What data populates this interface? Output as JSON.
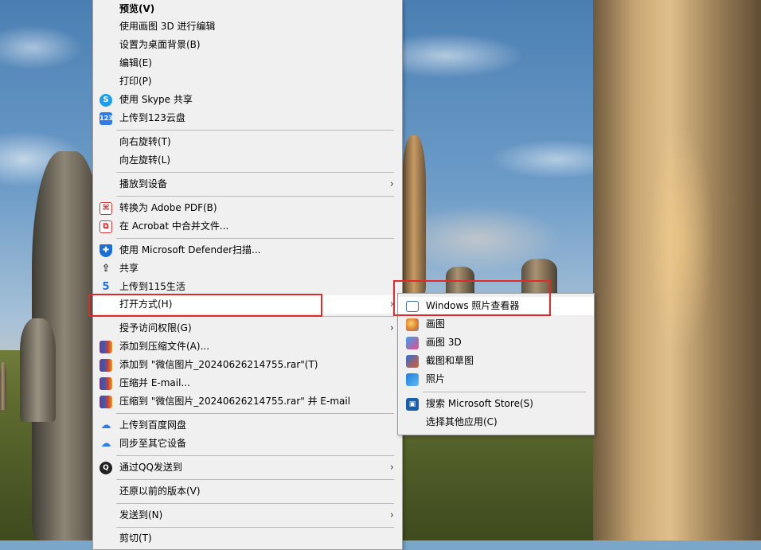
{
  "context_menu": {
    "items": [
      {
        "label": "预览(V)"
      },
      {
        "label": "使用画图 3D 进行编辑"
      },
      {
        "label": "设置为桌面背景(B)"
      },
      {
        "label": "编辑(E)"
      },
      {
        "label": "打印(P)"
      },
      {
        "label": "使用 Skype 共享",
        "icon": "skype-icon"
      },
      {
        "label": "上传到123云盘",
        "icon": "123-cloud-icon",
        "icon_text": "123"
      },
      {
        "label": "向右旋转(T)"
      },
      {
        "label": "向左旋转(L)"
      },
      {
        "label": "播放到设备",
        "has_submenu": true
      },
      {
        "label": "转换为 Adobe PDF(B)",
        "icon": "adobe-pdf-icon"
      },
      {
        "label": "在 Acrobat 中合并文件...",
        "icon": "acrobat-combine-icon"
      },
      {
        "label": "使用 Microsoft Defender扫描...",
        "icon": "defender-shield-icon"
      },
      {
        "label": "共享",
        "icon": "share-icon"
      },
      {
        "label": "上传到115生活",
        "icon": "115-icon"
      },
      {
        "label": "打开方式(H)",
        "has_submenu": true,
        "highlighted": true
      },
      {
        "label": "授予访问权限(G)",
        "has_submenu": true
      },
      {
        "label": "添加到压缩文件(A)...",
        "icon": "winrar-icon"
      },
      {
        "label": "添加到 \"微信图片_20240626214755.rar\"(T)",
        "icon": "winrar-icon"
      },
      {
        "label": "压缩并 E-mail...",
        "icon": "winrar-icon"
      },
      {
        "label": "压缩到 \"微信图片_20240626214755.rar\" 并 E-mail",
        "icon": "winrar-icon"
      },
      {
        "label": "上传到百度网盘",
        "icon": "baidu-netdisk-icon"
      },
      {
        "label": "同步至其它设备",
        "icon": "baidu-sync-icon"
      },
      {
        "label": "通过QQ发送到",
        "icon": "qq-icon",
        "has_submenu": true
      },
      {
        "label": "还原以前的版本(V)"
      },
      {
        "label": "发送到(N)",
        "has_submenu": true
      },
      {
        "label": "剪切(T)"
      }
    ],
    "submenu_arrow": "›"
  },
  "open_with_submenu": {
    "items": [
      {
        "label": "Windows 照片查看器",
        "icon": "photo-viewer-icon"
      },
      {
        "label": "画图",
        "icon": "paint-icon"
      },
      {
        "label": "画图 3D",
        "icon": "paint3d-icon"
      },
      {
        "label": "截图和草图",
        "icon": "snip-sketch-icon"
      },
      {
        "label": "照片",
        "icon": "photos-icon"
      },
      {
        "label": "搜索 Microsoft Store(S)",
        "icon": "store-icon"
      },
      {
        "label": "选择其他应用(C)"
      }
    ]
  },
  "colors": {
    "highlight_box": "#e12b2b",
    "menu_bg": "#f0f0f0"
  }
}
